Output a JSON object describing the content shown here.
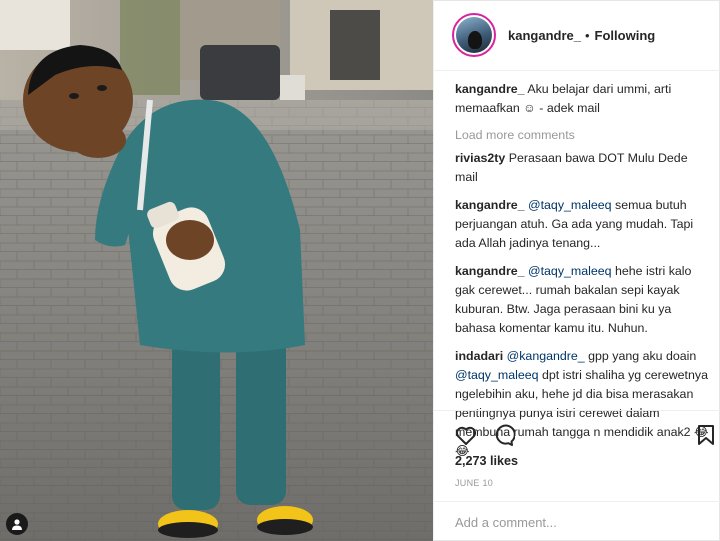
{
  "post": {
    "username": "kangandre_",
    "separator": "•",
    "follow_status": "Following",
    "caption": {
      "username": "kangandre_",
      "text": "Aku belajar dari ummi, arti memaafkan ☺ - adek mail"
    },
    "load_more": "Load more comments",
    "comments": [
      {
        "username": "rivias2ty",
        "mention": "",
        "text": "Perasaan bawa DOT Mulu Dede mail"
      },
      {
        "username": "kangandre_",
        "mention": "@taqy_maleeq",
        "text": "semua butuh perjuangan atuh. Ga ada yang mudah. Tapi ada Allah jadinya tenang..."
      },
      {
        "username": "kangandre_",
        "mention": "@taqy_maleeq",
        "text": "hehe istri kalo gak cerewet... rumah bakalan sepi kayak kuburan. Btw. Jaga perasaan bini ku ya bahasa komentar kamu itu. Nuhun."
      },
      {
        "username": "indadari",
        "mention": "@kangandre_",
        "text": "gpp yang aku doain",
        "mention2": "@taqy_maleeq",
        "text2": "dpt istri shaliha yg cerewetnya ngelebihin aku, hehe jd dia bisa merasakan pentingnya punya istri cerewet dalam membuna rumah tangga n mendidik anak2 😂😂"
      }
    ],
    "likes": "2,273 likes",
    "date": "JUNE 10",
    "add_comment_placeholder": "Add a comment..."
  },
  "icons": {
    "like": "heart-icon",
    "comment": "speech-bubble-icon",
    "save": "bookmark-icon",
    "tagged": "person-tag-icon"
  },
  "colors": {
    "text": "#262626",
    "mention": "#003569",
    "muted": "#999999",
    "story_ring": "#d6249f",
    "border": "#efefef"
  }
}
